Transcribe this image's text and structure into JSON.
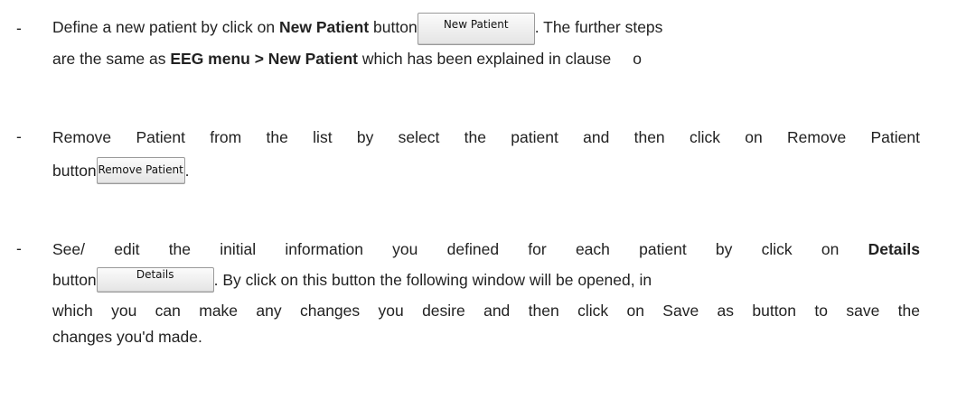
{
  "bullets": [
    {
      "dash": "-",
      "line1": {
        "text_a": "Define a new patient by click on ",
        "bold_a": "New Patient",
        "text_b": " button",
        "button_label": "New Patient",
        "text_c": ". The further steps"
      },
      "line2": {
        "text_a": "are the same as ",
        "bold_a": "EEG menu > New Patient",
        "text_b": " which has been explained in clause",
        "clause_ref": "o"
      }
    },
    {
      "dash": "-",
      "line1": {
        "text_a": "Remove Patient from the list by select the patient and then click on Remove Patient"
      },
      "line2": {
        "text_a": "button",
        "button_label": "Remove Patient",
        "text_b": "."
      }
    },
    {
      "dash": "-",
      "line1": {
        "text_a": "See/ edit the initial information you defined for each patient by click on ",
        "bold_a": "Details"
      },
      "line2": {
        "text_a": "button",
        "button_label": "Details",
        "text_b": ". By click on this button the following window will be opened, in"
      },
      "line3": {
        "text_a": "which you can make any changes you desire and then click on Save as button to save the"
      },
      "line4": {
        "text_a": "changes you'd made."
      }
    }
  ]
}
